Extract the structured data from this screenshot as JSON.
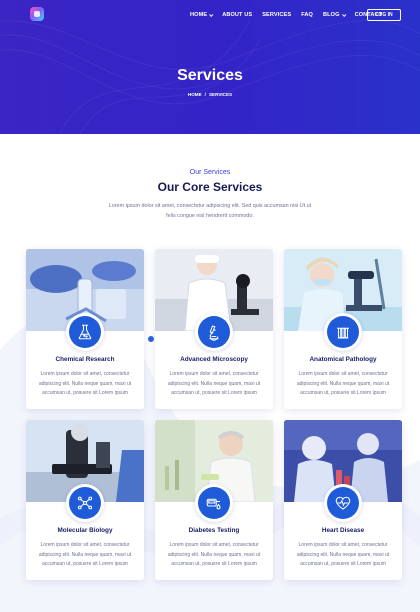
{
  "nav": {
    "items": [
      {
        "label": "HOME",
        "dropdown": true
      },
      {
        "label": "ABOUT US",
        "dropdown": false
      },
      {
        "label": "SERVICES",
        "dropdown": false
      },
      {
        "label": "FAQ",
        "dropdown": false
      },
      {
        "label": "BLOG",
        "dropdown": true
      },
      {
        "label": "CONTACT",
        "dropdown": false
      }
    ],
    "login_label": "LOG IN"
  },
  "hero": {
    "title": "Services",
    "breadcrumb": [
      "HOME",
      "/",
      "SERVICES"
    ]
  },
  "intro": {
    "eyebrow": "Our Services",
    "title": "Our Core Services",
    "text": "Lorem ipsum dolor sit amet, consectetur adipiscing elit. Sed quis accumsan nisi Ut ut felis congue nisl hendrerit commodo."
  },
  "services": [
    {
      "title": "Chemical Research",
      "text": "Lorem ipsum dolor sit amet, consectetur adipiscing elit. Nulla neque quam, maxi ut accumsan ut, posuere sit Lorem ipsum",
      "icon": "beaker-icon"
    },
    {
      "title": "Advanced Microscopy",
      "text": "Lorem ipsum dolor sit amet, consectetur adipiscing elit. Nulla neque quam, maxi ut accumsan ut, posuere sit Lorem ipsum",
      "icon": "microscope-icon"
    },
    {
      "title": "Anatomical Pathology",
      "text": "Lorem ipsum dolor sit amet, consectetur adipiscing elit. Nulla neque quam, maxi ut accumsan ut, posuere sit Lorem ipsum",
      "icon": "test-tubes-icon"
    },
    {
      "title": "Molecular Biology",
      "text": "Lorem ipsum dolor sit amet, consectetur adipiscing elit. Nulla neque quam, maxi ut accumsan ut, posuere sit Lorem ipsum",
      "icon": "molecule-icon"
    },
    {
      "title": "Diabetes Testing",
      "text": "Lorem ipsum dolor sit amet, consectetur adipiscing elit. Nulla neque quam, maxi ut accumsan ut, posuere sit Lorem ipsum",
      "icon": "glucose-meter-icon"
    },
    {
      "title": "Heart Disease",
      "text": "Lorem ipsum dolor sit amet, consectetur adipiscing elit. Nulla neque quam, maxi ut accumsan ut, posuere sit Lorem ipsum",
      "icon": "heart-pulse-icon"
    }
  ],
  "colors": {
    "hero": "#3324c7",
    "accent": "#1f5bd8",
    "title": "#161b52"
  }
}
